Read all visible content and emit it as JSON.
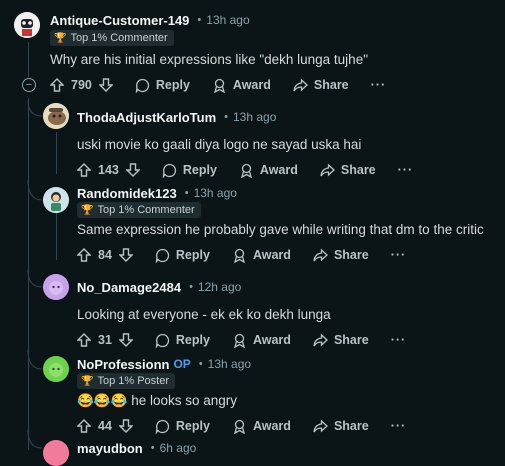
{
  "comments": [
    {
      "username": "Antique-Customer-149",
      "time": "13h ago",
      "flair": "Top 1% Commenter",
      "body": "Why are his initial expressions like \"dekh lunga tujhe\"",
      "votes": "790",
      "reply": "Reply",
      "award": "Award",
      "share": "Share",
      "more": "···"
    },
    {
      "username": "ThodaAdjustKarloTum",
      "time": "13h ago",
      "body": "uski movie ko gaali diya logo ne sayad uska hai",
      "votes": "143",
      "reply": "Reply",
      "award": "Award",
      "share": "Share",
      "more": "···"
    },
    {
      "username": "Randomidek123",
      "time": "13h ago",
      "flair": "Top 1% Commenter",
      "body": "Same expression he probably gave while writing that dm to the critic",
      "votes": "84",
      "reply": "Reply",
      "award": "Award",
      "share": "Share",
      "more": "···"
    },
    {
      "username": "No_Damage2484",
      "time": "12h ago",
      "body": "Looking at everyone - ek ek ko dekh lunga",
      "votes": "31",
      "reply": "Reply",
      "award": "Award",
      "share": "Share",
      "more": "···"
    },
    {
      "username": "NoProfessionn",
      "op": "OP",
      "time": "13h ago",
      "flair": "Top 1% Poster",
      "emoji": "😂😂😂",
      "body": " he looks so angry",
      "votes": "44",
      "reply": "Reply",
      "award": "Award",
      "share": "Share",
      "more": "···"
    },
    {
      "username": "mayudbon",
      "time": "6h ago"
    }
  ],
  "collapse_symbol": "−",
  "dot": "•"
}
